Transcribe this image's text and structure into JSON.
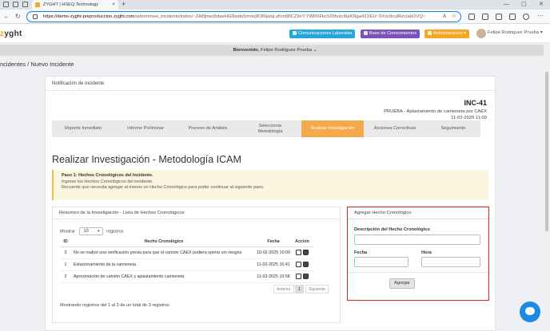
{
  "browser": {
    "tab_title": "ZYGHT | HSEQ Technology",
    "url_host": "https://demo-zyght-preproduccion.zyght.com",
    "url_path": "/admin/new_incidents/index/~ZABjhwo5daeHGNwdu5mvwjR36tjalqLzKm6BCZ9nY.YWR5Fbc565hulcI6pKNga4ZXEU~5Xvc6rcdRzUabOVQ~",
    "new_tab": "+",
    "reader": "A",
    "star": "☆"
  },
  "topnav": {
    "logo_prefix": "z",
    "logo_rest": "yght",
    "btn_comunicaciones": "Comunicaciones Laborales",
    "btn_base": "Base de Conocimientos",
    "btn_admin": "Administración ▾",
    "user": "Felipe Rodriguez Prueba ▾",
    "colors": {
      "comunicaciones": "#26a7d9",
      "base": "#7b52b9",
      "admin": "#f5a623"
    }
  },
  "welcome": {
    "label": "Bienvenido,",
    "name": "Felipe Rodriguez Prueba"
  },
  "breadcrumb": "ncidentes / Nuevo Incidente",
  "panel": {
    "header": "Notificación de Incidente",
    "incident_id": "INC-41",
    "incident_desc": "PRUEBA - Aplastamiento de camioneta por CAEX",
    "incident_date": "11-02-2025 11:00"
  },
  "steps": [
    {
      "label": "Reporte Inmediato"
    },
    {
      "label": "Informe Preliminar"
    },
    {
      "label": "Proceso de Análisis"
    },
    {
      "label": "Seleccionar Metodología"
    },
    {
      "label": "Realizar Investigación",
      "active": true
    },
    {
      "label": "Acciones Correctivas"
    },
    {
      "label": "Seguimiento"
    }
  ],
  "page_title": "Realizar Investigación - Metodología ICAM",
  "alert": {
    "title": "Paso 1: Hechos Cronológicos del Incidente.",
    "line1": "Ingrese los Hechos Cronológicos del incidente.",
    "line2": "Recuerde que necesita agregar al menos un Hecho Cronológico para poder continuar al siguiente paso."
  },
  "summary": {
    "title": "Resumen de la Investigación - Lista de Hechos Cronológicos",
    "show_label": "Mostrar",
    "show_value": "10",
    "show_suffix": "registros",
    "columns": [
      "ID",
      "Hecho Cronológico",
      "Fecha",
      "Acción"
    ],
    "rows": [
      {
        "id": "3",
        "hecho": "No se realizó una verificación previa para que el camión CAEX pudiera operar sin riesgos",
        "fecha": "10-02-2025 10:00"
      },
      {
        "id": "1",
        "hecho": "Estacionamiento de la camioneta",
        "fecha": "11-02-2025 10:41"
      },
      {
        "id": "2",
        "hecho": "Aproximación de camión CAEX y aplastamiento camioneta",
        "fecha": "11-02-2025 10:58"
      }
    ],
    "pager": {
      "prev": "Anterior",
      "page": "1",
      "next": "Siguiente"
    },
    "showing": "Mostrando registros del 1 al 3 de un total de 3 registros"
  },
  "add_form": {
    "title": "Agregar Hecho Cronológico",
    "desc_label": "Descripción del Hecho Cronológico",
    "fecha_label": "Fecha",
    "hora_label": "Hora",
    "button": "Agregar"
  }
}
